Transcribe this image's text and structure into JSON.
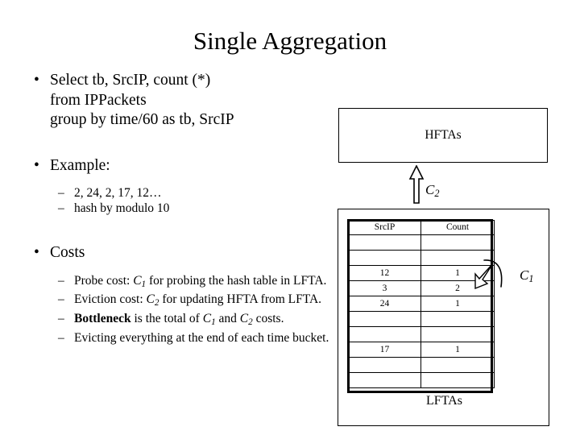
{
  "slide": {
    "title": "Single Aggregation"
  },
  "body": {
    "bullet1": {
      "marker": "•",
      "line1": "Select tb, SrcIP, count (*)",
      "line2": "from IPPackets",
      "line3": "group by time/60 as tb, SrcIP"
    },
    "bullet2": {
      "marker": "•",
      "label": "Example:",
      "sub_marker": "–",
      "sub1": "2, 24, 2, 17, 12…",
      "sub2": "hash by modulo 10"
    },
    "bullet3": {
      "marker": "•",
      "label": "Costs",
      "sub_marker": "–",
      "sub1_pre": "Probe cost: ",
      "sub1_var": "C",
      "sub1_varsub": "1",
      "sub1_post": " for probing the hash table in LFTA.",
      "sub2_pre": "Eviction cost: ",
      "sub2_var": "C",
      "sub2_varsub": "2",
      "sub2_post": " for updating HFTA from LFTA.",
      "sub3_bold": "Bottleneck",
      "sub3_mid": " is the total of ",
      "sub3_var1": "C",
      "sub3_var1sub": "1",
      "sub3_and": " and ",
      "sub3_var2": "C",
      "sub3_var2sub": "2",
      "sub3_post": " costs.",
      "sub4": "Evicting everything at the end of each time bucket."
    }
  },
  "diagram": {
    "hfta_label": "HFTAs",
    "lfta_label": "LFTAs",
    "c2_label_var": "C",
    "c2_label_sub": "2",
    "c1_label_var": "C",
    "c1_label_sub": "1",
    "table": {
      "headers": [
        "SrcIP",
        "Count"
      ],
      "rows": [
        [
          "",
          ""
        ],
        [
          "",
          ""
        ],
        [
          "12",
          "1"
        ],
        [
          "3",
          "2"
        ],
        [
          "24",
          "1"
        ],
        [
          "",
          ""
        ],
        [
          "",
          ""
        ],
        [
          "17",
          "1"
        ],
        [
          "",
          ""
        ],
        [
          "",
          ""
        ]
      ]
    },
    "colors": {
      "line": "#000000",
      "background": "#ffffff",
      "text": "#000000"
    }
  }
}
